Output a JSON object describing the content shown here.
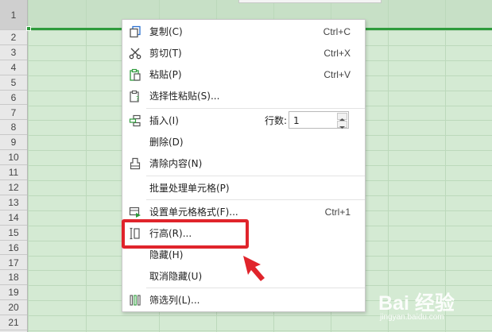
{
  "spreadsheet": {
    "row_numbers": [
      "1",
      "2",
      "3",
      "4",
      "5",
      "6",
      "7",
      "8",
      "9",
      "10",
      "11",
      "12",
      "13",
      "14",
      "15",
      "16",
      "17",
      "18",
      "19",
      "20",
      "21"
    ]
  },
  "context_menu": {
    "items": [
      {
        "label": "复制(C)",
        "shortcut": "Ctrl+C",
        "icon": "copy-icon"
      },
      {
        "label": "剪切(T)",
        "shortcut": "Ctrl+X",
        "icon": "scissors-icon"
      },
      {
        "label": "粘贴(P)",
        "shortcut": "Ctrl+V",
        "icon": "paste-icon"
      },
      {
        "label": "选择性粘贴(S)...",
        "shortcut": "",
        "icon": "paste-special-icon"
      },
      {
        "label": "插入(I)",
        "shortcut": "",
        "icon": "insert-row-icon"
      },
      {
        "label": "删除(D)",
        "shortcut": "",
        "icon": ""
      },
      {
        "label": "清除内容(N)",
        "shortcut": "",
        "icon": "eraser-icon"
      },
      {
        "label": "批量处理单元格(P)",
        "shortcut": "",
        "icon": ""
      },
      {
        "label": "设置单元格格式(F)...",
        "shortcut": "Ctrl+1",
        "icon": "format-cells-icon"
      },
      {
        "label": "行高(R)...",
        "shortcut": "",
        "icon": "row-height-icon"
      },
      {
        "label": "隐藏(H)",
        "shortcut": "",
        "icon": ""
      },
      {
        "label": "取消隐藏(U)",
        "shortcut": "",
        "icon": ""
      },
      {
        "label": "筛选列(L)...",
        "shortcut": "",
        "icon": "filter-columns-icon"
      }
    ],
    "row_count": {
      "label": "行数:",
      "value": "1"
    }
  },
  "watermark": {
    "main": "Bai 经验",
    "sub": "jingyan.baidu.com"
  },
  "colors": {
    "highlight": "#e0242b",
    "selection": "#2e9b3c",
    "sheet_bg": "#d4ead3"
  }
}
